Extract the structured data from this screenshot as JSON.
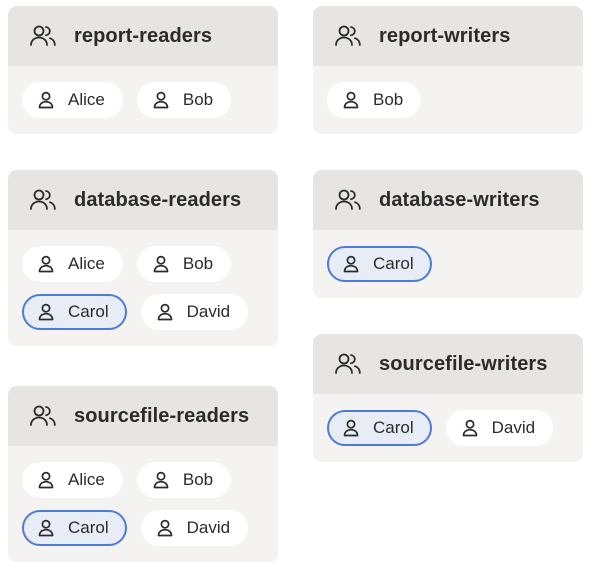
{
  "groups": [
    {
      "title": "report-readers",
      "icon": "users-icon",
      "members": [
        {
          "name": "Alice",
          "selected": false
        },
        {
          "name": "Bob",
          "selected": false
        }
      ]
    },
    {
      "title": "report-writers",
      "icon": "users-icon",
      "members": [
        {
          "name": "Bob",
          "selected": false
        }
      ]
    },
    {
      "title": "database-readers",
      "icon": "users-icon",
      "members": [
        {
          "name": "Alice",
          "selected": false
        },
        {
          "name": "Bob",
          "selected": false
        },
        {
          "name": "Carol",
          "selected": true
        },
        {
          "name": "David",
          "selected": false
        }
      ]
    },
    {
      "title": "database-writers",
      "icon": "users-icon",
      "members": [
        {
          "name": "Carol",
          "selected": true
        }
      ]
    },
    {
      "title": "sourcefile-writers",
      "icon": "users-icon",
      "members": [
        {
          "name": "Carol",
          "selected": true
        },
        {
          "name": "David",
          "selected": false
        }
      ]
    },
    {
      "title": "sourcefile-readers",
      "icon": "users-icon",
      "members": [
        {
          "name": "Alice",
          "selected": false
        },
        {
          "name": "Bob",
          "selected": false
        },
        {
          "name": "Carol",
          "selected": true
        },
        {
          "name": "David",
          "selected": false
        }
      ]
    }
  ],
  "colors": {
    "selected_border": "#4e7bd6",
    "selected_fill": "#e7ecf7",
    "card": "#f4f3f2",
    "header": "#e6e5e3"
  }
}
